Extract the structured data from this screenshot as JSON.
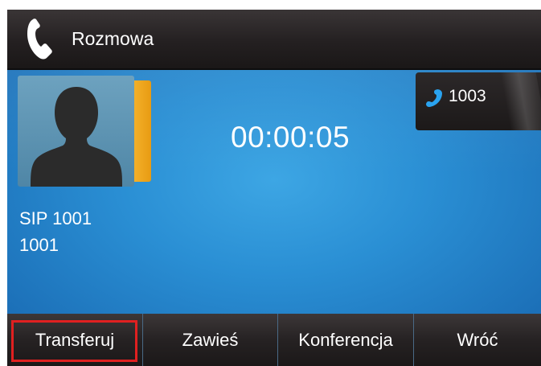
{
  "title_bar": {
    "icon": "handset-icon",
    "title": "Rozmowa"
  },
  "call": {
    "contact_name": "SIP 1001",
    "contact_number": "1001",
    "duration": "00:00:05",
    "avatar_icon": "person-silhouette-icon"
  },
  "line": {
    "icon": "phone-icon",
    "label": "1003"
  },
  "softkeys": [
    {
      "label": "Transferuj",
      "highlighted": true
    },
    {
      "label": "Zawieś",
      "highlighted": false
    },
    {
      "label": "Konferencja",
      "highlighted": false
    },
    {
      "label": "Wróć",
      "highlighted": false
    }
  ],
  "colors": {
    "background_blue": "#2a8fd4",
    "avatar_tab": "#f3b02a",
    "highlight_border": "#e02020",
    "bar_dark": "#242021"
  }
}
